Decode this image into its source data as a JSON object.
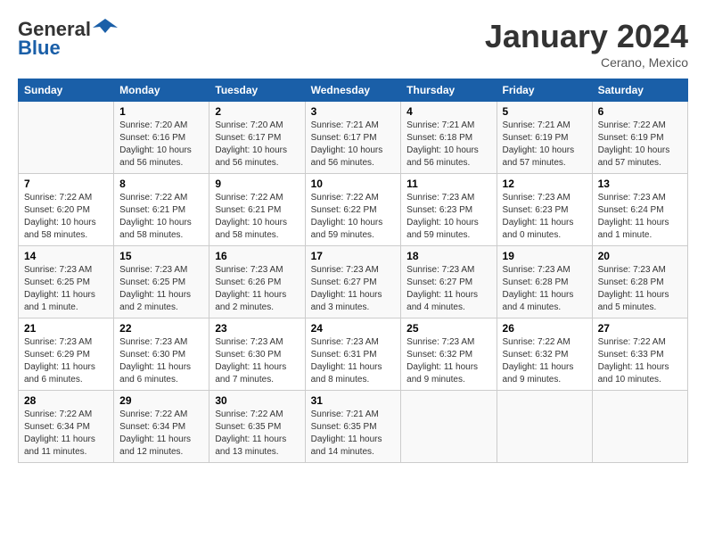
{
  "header": {
    "logo_line1": "General",
    "logo_line2": "Blue",
    "month": "January 2024",
    "location": "Cerano, Mexico"
  },
  "weekdays": [
    "Sunday",
    "Monday",
    "Tuesday",
    "Wednesday",
    "Thursday",
    "Friday",
    "Saturday"
  ],
  "weeks": [
    [
      {
        "day": "",
        "info": ""
      },
      {
        "day": "1",
        "info": "Sunrise: 7:20 AM\nSunset: 6:16 PM\nDaylight: 10 hours\nand 56 minutes."
      },
      {
        "day": "2",
        "info": "Sunrise: 7:20 AM\nSunset: 6:17 PM\nDaylight: 10 hours\nand 56 minutes."
      },
      {
        "day": "3",
        "info": "Sunrise: 7:21 AM\nSunset: 6:17 PM\nDaylight: 10 hours\nand 56 minutes."
      },
      {
        "day": "4",
        "info": "Sunrise: 7:21 AM\nSunset: 6:18 PM\nDaylight: 10 hours\nand 56 minutes."
      },
      {
        "day": "5",
        "info": "Sunrise: 7:21 AM\nSunset: 6:19 PM\nDaylight: 10 hours\nand 57 minutes."
      },
      {
        "day": "6",
        "info": "Sunrise: 7:22 AM\nSunset: 6:19 PM\nDaylight: 10 hours\nand 57 minutes."
      }
    ],
    [
      {
        "day": "7",
        "info": "Sunrise: 7:22 AM\nSunset: 6:20 PM\nDaylight: 10 hours\nand 58 minutes."
      },
      {
        "day": "8",
        "info": "Sunrise: 7:22 AM\nSunset: 6:21 PM\nDaylight: 10 hours\nand 58 minutes."
      },
      {
        "day": "9",
        "info": "Sunrise: 7:22 AM\nSunset: 6:21 PM\nDaylight: 10 hours\nand 58 minutes."
      },
      {
        "day": "10",
        "info": "Sunrise: 7:22 AM\nSunset: 6:22 PM\nDaylight: 10 hours\nand 59 minutes."
      },
      {
        "day": "11",
        "info": "Sunrise: 7:23 AM\nSunset: 6:23 PM\nDaylight: 10 hours\nand 59 minutes."
      },
      {
        "day": "12",
        "info": "Sunrise: 7:23 AM\nSunset: 6:23 PM\nDaylight: 11 hours\nand 0 minutes."
      },
      {
        "day": "13",
        "info": "Sunrise: 7:23 AM\nSunset: 6:24 PM\nDaylight: 11 hours\nand 1 minute."
      }
    ],
    [
      {
        "day": "14",
        "info": "Sunrise: 7:23 AM\nSunset: 6:25 PM\nDaylight: 11 hours\nand 1 minute."
      },
      {
        "day": "15",
        "info": "Sunrise: 7:23 AM\nSunset: 6:25 PM\nDaylight: 11 hours\nand 2 minutes."
      },
      {
        "day": "16",
        "info": "Sunrise: 7:23 AM\nSunset: 6:26 PM\nDaylight: 11 hours\nand 2 minutes."
      },
      {
        "day": "17",
        "info": "Sunrise: 7:23 AM\nSunset: 6:27 PM\nDaylight: 11 hours\nand 3 minutes."
      },
      {
        "day": "18",
        "info": "Sunrise: 7:23 AM\nSunset: 6:27 PM\nDaylight: 11 hours\nand 4 minutes."
      },
      {
        "day": "19",
        "info": "Sunrise: 7:23 AM\nSunset: 6:28 PM\nDaylight: 11 hours\nand 4 minutes."
      },
      {
        "day": "20",
        "info": "Sunrise: 7:23 AM\nSunset: 6:28 PM\nDaylight: 11 hours\nand 5 minutes."
      }
    ],
    [
      {
        "day": "21",
        "info": "Sunrise: 7:23 AM\nSunset: 6:29 PM\nDaylight: 11 hours\nand 6 minutes."
      },
      {
        "day": "22",
        "info": "Sunrise: 7:23 AM\nSunset: 6:30 PM\nDaylight: 11 hours\nand 6 minutes."
      },
      {
        "day": "23",
        "info": "Sunrise: 7:23 AM\nSunset: 6:30 PM\nDaylight: 11 hours\nand 7 minutes."
      },
      {
        "day": "24",
        "info": "Sunrise: 7:23 AM\nSunset: 6:31 PM\nDaylight: 11 hours\nand 8 minutes."
      },
      {
        "day": "25",
        "info": "Sunrise: 7:23 AM\nSunset: 6:32 PM\nDaylight: 11 hours\nand 9 minutes."
      },
      {
        "day": "26",
        "info": "Sunrise: 7:22 AM\nSunset: 6:32 PM\nDaylight: 11 hours\nand 9 minutes."
      },
      {
        "day": "27",
        "info": "Sunrise: 7:22 AM\nSunset: 6:33 PM\nDaylight: 11 hours\nand 10 minutes."
      }
    ],
    [
      {
        "day": "28",
        "info": "Sunrise: 7:22 AM\nSunset: 6:34 PM\nDaylight: 11 hours\nand 11 minutes."
      },
      {
        "day": "29",
        "info": "Sunrise: 7:22 AM\nSunset: 6:34 PM\nDaylight: 11 hours\nand 12 minutes."
      },
      {
        "day": "30",
        "info": "Sunrise: 7:22 AM\nSunset: 6:35 PM\nDaylight: 11 hours\nand 13 minutes."
      },
      {
        "day": "31",
        "info": "Sunrise: 7:21 AM\nSunset: 6:35 PM\nDaylight: 11 hours\nand 14 minutes."
      },
      {
        "day": "",
        "info": ""
      },
      {
        "day": "",
        "info": ""
      },
      {
        "day": "",
        "info": ""
      }
    ]
  ]
}
